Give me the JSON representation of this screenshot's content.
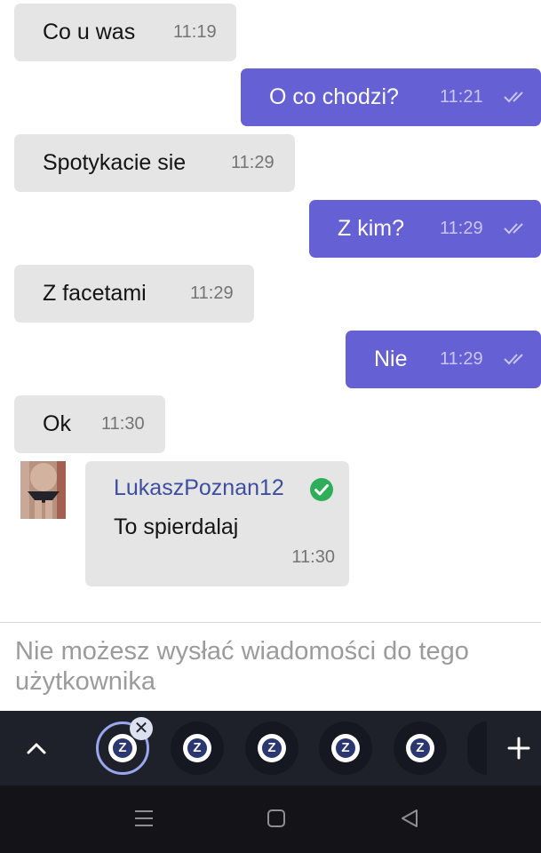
{
  "messages": [
    {
      "text": "Co u was",
      "time": "11:19",
      "dir": "in"
    },
    {
      "text": "O co chodzi?",
      "time": "11:21",
      "dir": "out"
    },
    {
      "text": "Spotykacie sie",
      "time": "11:29",
      "dir": "in"
    },
    {
      "text": "Z kim?",
      "time": "11:29",
      "dir": "out"
    },
    {
      "text": "Z facetami",
      "time": "11:29",
      "dir": "in"
    },
    {
      "text": "Nie",
      "time": "11:29",
      "dir": "out"
    },
    {
      "text": "Ok",
      "time": "11:30",
      "dir": "in"
    }
  ],
  "last_message": {
    "username": "LukaszPoznan12",
    "verified": true,
    "text": "To spierdalaj",
    "time": "11:30"
  },
  "composer": {
    "notice": "Nie możesz wysłać wiadomości do tego użytkownika"
  },
  "tabs": {
    "logo_letter": "Z",
    "close_glyph": "✕",
    "add_glyph": "+",
    "count": 5,
    "active_index": 0
  },
  "icons": {
    "read_receipt": "double-check-icon",
    "verified": "verified-check-icon",
    "collapse": "chevron-up-icon",
    "add": "plus-icon",
    "nav": [
      "menu-icon",
      "home-icon",
      "back-icon"
    ]
  },
  "colors": {
    "incoming_bubble": "#e5e5e5",
    "outgoing_bubble": "#6560d3",
    "username": "#3d4ea0",
    "verified_badge": "#2fae5a",
    "tab_bar": "#1e2129"
  }
}
